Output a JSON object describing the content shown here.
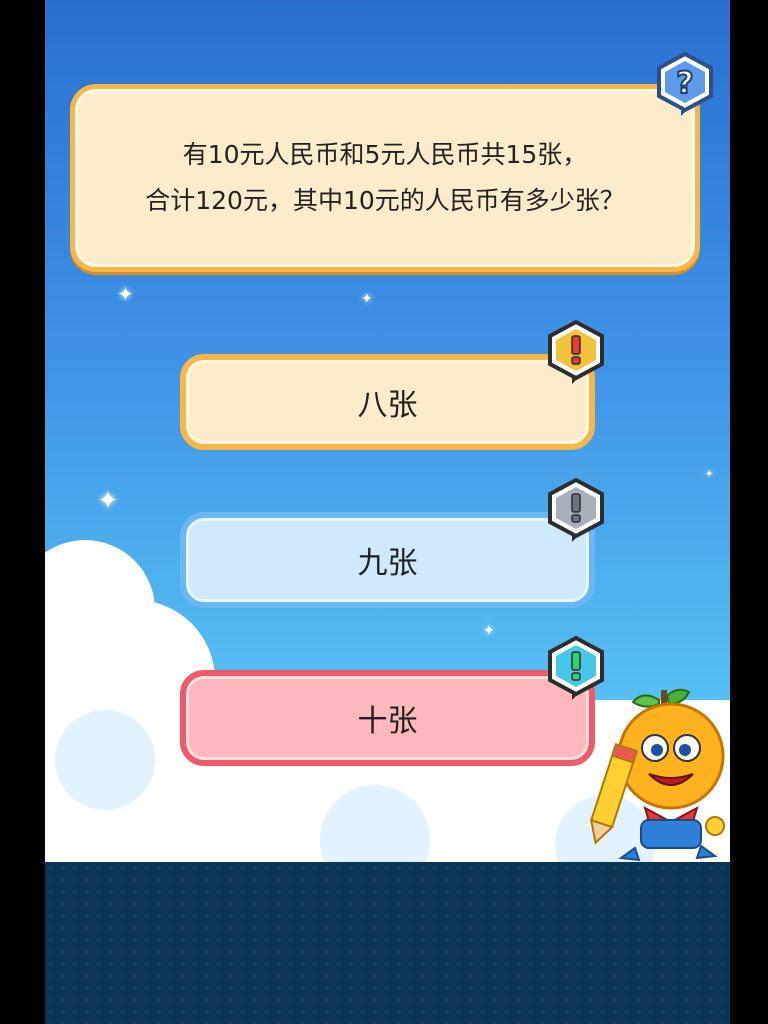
{
  "question": {
    "line1": "有10元人民币和5元人民币共15张，",
    "line2": "合计120元，其中10元的人民币有多少张？"
  },
  "options": [
    {
      "label": "八张",
      "badge_icon": "exclamation-icon",
      "badge_color": "#f3c23b"
    },
    {
      "label": "九张",
      "badge_icon": "exclamation-icon",
      "badge_color": "#a7b0bb"
    },
    {
      "label": "十张",
      "badge_icon": "exclamation-icon",
      "badge_color": "#49c7e8"
    }
  ],
  "question_badge_icon": "question-mark-icon",
  "colors": {
    "question_border": "#f7b64a",
    "option_a_border": "#f7b64a",
    "option_b_border": "#6ab8f2",
    "option_c_border": "#ef5a6a"
  }
}
